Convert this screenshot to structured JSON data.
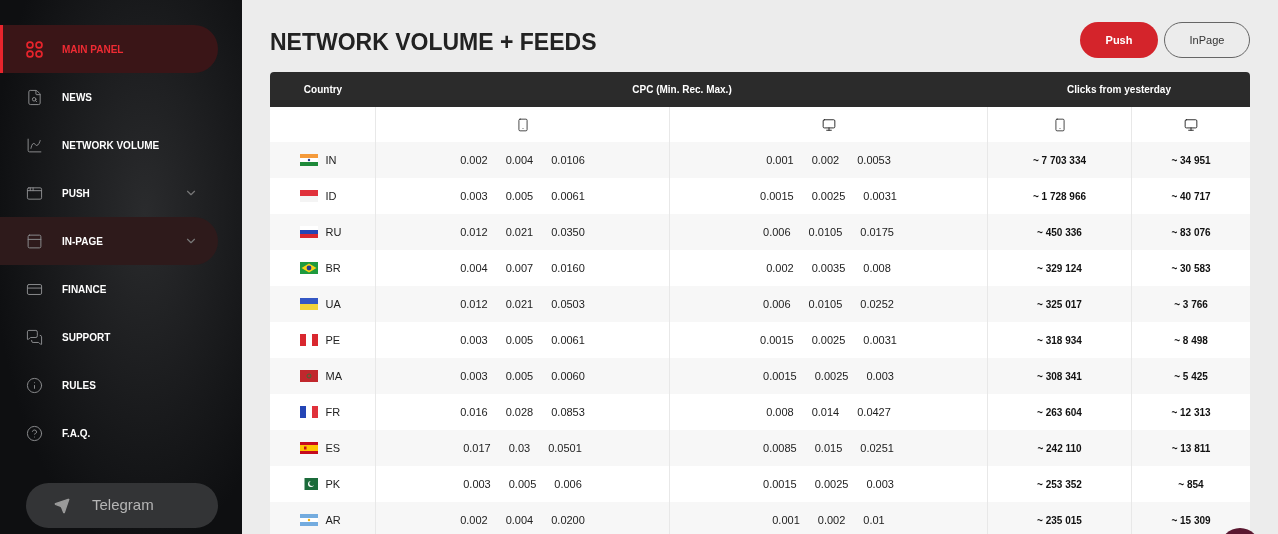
{
  "sidebar": {
    "items": [
      {
        "label": "MAIN PANEL",
        "selected": true,
        "hovered": false,
        "kind": "link"
      },
      {
        "label": "NEWS",
        "selected": false,
        "hovered": false,
        "kind": "link"
      },
      {
        "label": "NETWORK VOLUME",
        "selected": false,
        "hovered": false,
        "kind": "link"
      },
      {
        "label": "PUSH",
        "selected": false,
        "hovered": false,
        "kind": "submenu"
      },
      {
        "label": "IN-PAGE",
        "selected": false,
        "hovered": true,
        "kind": "submenu"
      },
      {
        "label": "FINANCE",
        "selected": false,
        "hovered": false,
        "kind": "link"
      },
      {
        "label": "SUPPORT",
        "selected": false,
        "hovered": false,
        "kind": "link"
      },
      {
        "label": "RULES",
        "selected": false,
        "hovered": false,
        "kind": "link"
      },
      {
        "label": "F.A.Q.",
        "selected": false,
        "hovered": false,
        "kind": "link"
      }
    ],
    "telegram": "Telegram"
  },
  "title": "NETWORK VOLUME + FEEDS",
  "tabs": [
    {
      "label": "Push",
      "selected": true
    },
    {
      "label": "InPage",
      "selected": false
    }
  ],
  "table": {
    "columns": [
      "Country",
      "CPC (Min. Rec. Max.)",
      "Clicks from yesterday"
    ],
    "rows": [
      {
        "country": "IN",
        "cpc_mobile": [
          "0.002",
          "0.004",
          "0.0106"
        ],
        "cpc_desktop": [
          "0.001",
          "0.002",
          "0.0053"
        ],
        "clicks_mobile": "~ 7 703 334",
        "clicks_desktop": "~ 34 951"
      },
      {
        "country": "ID",
        "cpc_mobile": [
          "0.003",
          "0.005",
          "0.0061"
        ],
        "cpc_desktop": [
          "0.0015",
          "0.0025",
          "0.0031"
        ],
        "clicks_mobile": "~ 1 728 966",
        "clicks_desktop": "~ 40 717"
      },
      {
        "country": "RU",
        "cpc_mobile": [
          "0.012",
          "0.021",
          "0.0350"
        ],
        "cpc_desktop": [
          "0.006",
          "0.0105",
          "0.0175"
        ],
        "clicks_mobile": "~ 450 336",
        "clicks_desktop": "~ 83 076"
      },
      {
        "country": "BR",
        "cpc_mobile": [
          "0.004",
          "0.007",
          "0.0160"
        ],
        "cpc_desktop": [
          "0.002",
          "0.0035",
          "0.008"
        ],
        "clicks_mobile": "~ 329 124",
        "clicks_desktop": "~ 30 583"
      },
      {
        "country": "UA",
        "cpc_mobile": [
          "0.012",
          "0.021",
          "0.0503"
        ],
        "cpc_desktop": [
          "0.006",
          "0.0105",
          "0.0252"
        ],
        "clicks_mobile": "~ 325 017",
        "clicks_desktop": "~ 3 766"
      },
      {
        "country": "PE",
        "cpc_mobile": [
          "0.003",
          "0.005",
          "0.0061"
        ],
        "cpc_desktop": [
          "0.0015",
          "0.0025",
          "0.0031"
        ],
        "clicks_mobile": "~ 318 934",
        "clicks_desktop": "~ 8 498"
      },
      {
        "country": "MA",
        "cpc_mobile": [
          "0.003",
          "0.005",
          "0.0060"
        ],
        "cpc_desktop": [
          "0.0015",
          "0.0025",
          "0.003"
        ],
        "clicks_mobile": "~ 308 341",
        "clicks_desktop": "~ 5 425"
      },
      {
        "country": "FR",
        "cpc_mobile": [
          "0.016",
          "0.028",
          "0.0853"
        ],
        "cpc_desktop": [
          "0.008",
          "0.014",
          "0.0427"
        ],
        "clicks_mobile": "~ 263 604",
        "clicks_desktop": "~ 12 313"
      },
      {
        "country": "ES",
        "cpc_mobile": [
          "0.017",
          "0.03",
          "0.0501"
        ],
        "cpc_desktop": [
          "0.0085",
          "0.015",
          "0.0251"
        ],
        "clicks_mobile": "~ 242 110",
        "clicks_desktop": "~ 13 811"
      },
      {
        "country": "PK",
        "cpc_mobile": [
          "0.003",
          "0.005",
          "0.006"
        ],
        "cpc_desktop": [
          "0.0015",
          "0.0025",
          "0.003"
        ],
        "clicks_mobile": "~ 253 352",
        "clicks_desktop": "~ 854"
      },
      {
        "country": "AR",
        "cpc_mobile": [
          "0.002",
          "0.004",
          "0.0200"
        ],
        "cpc_desktop": [
          "0.001",
          "0.002",
          "0.01"
        ],
        "clicks_mobile": "~ 235 015",
        "clicks_desktop": "~ 15 309"
      }
    ]
  }
}
